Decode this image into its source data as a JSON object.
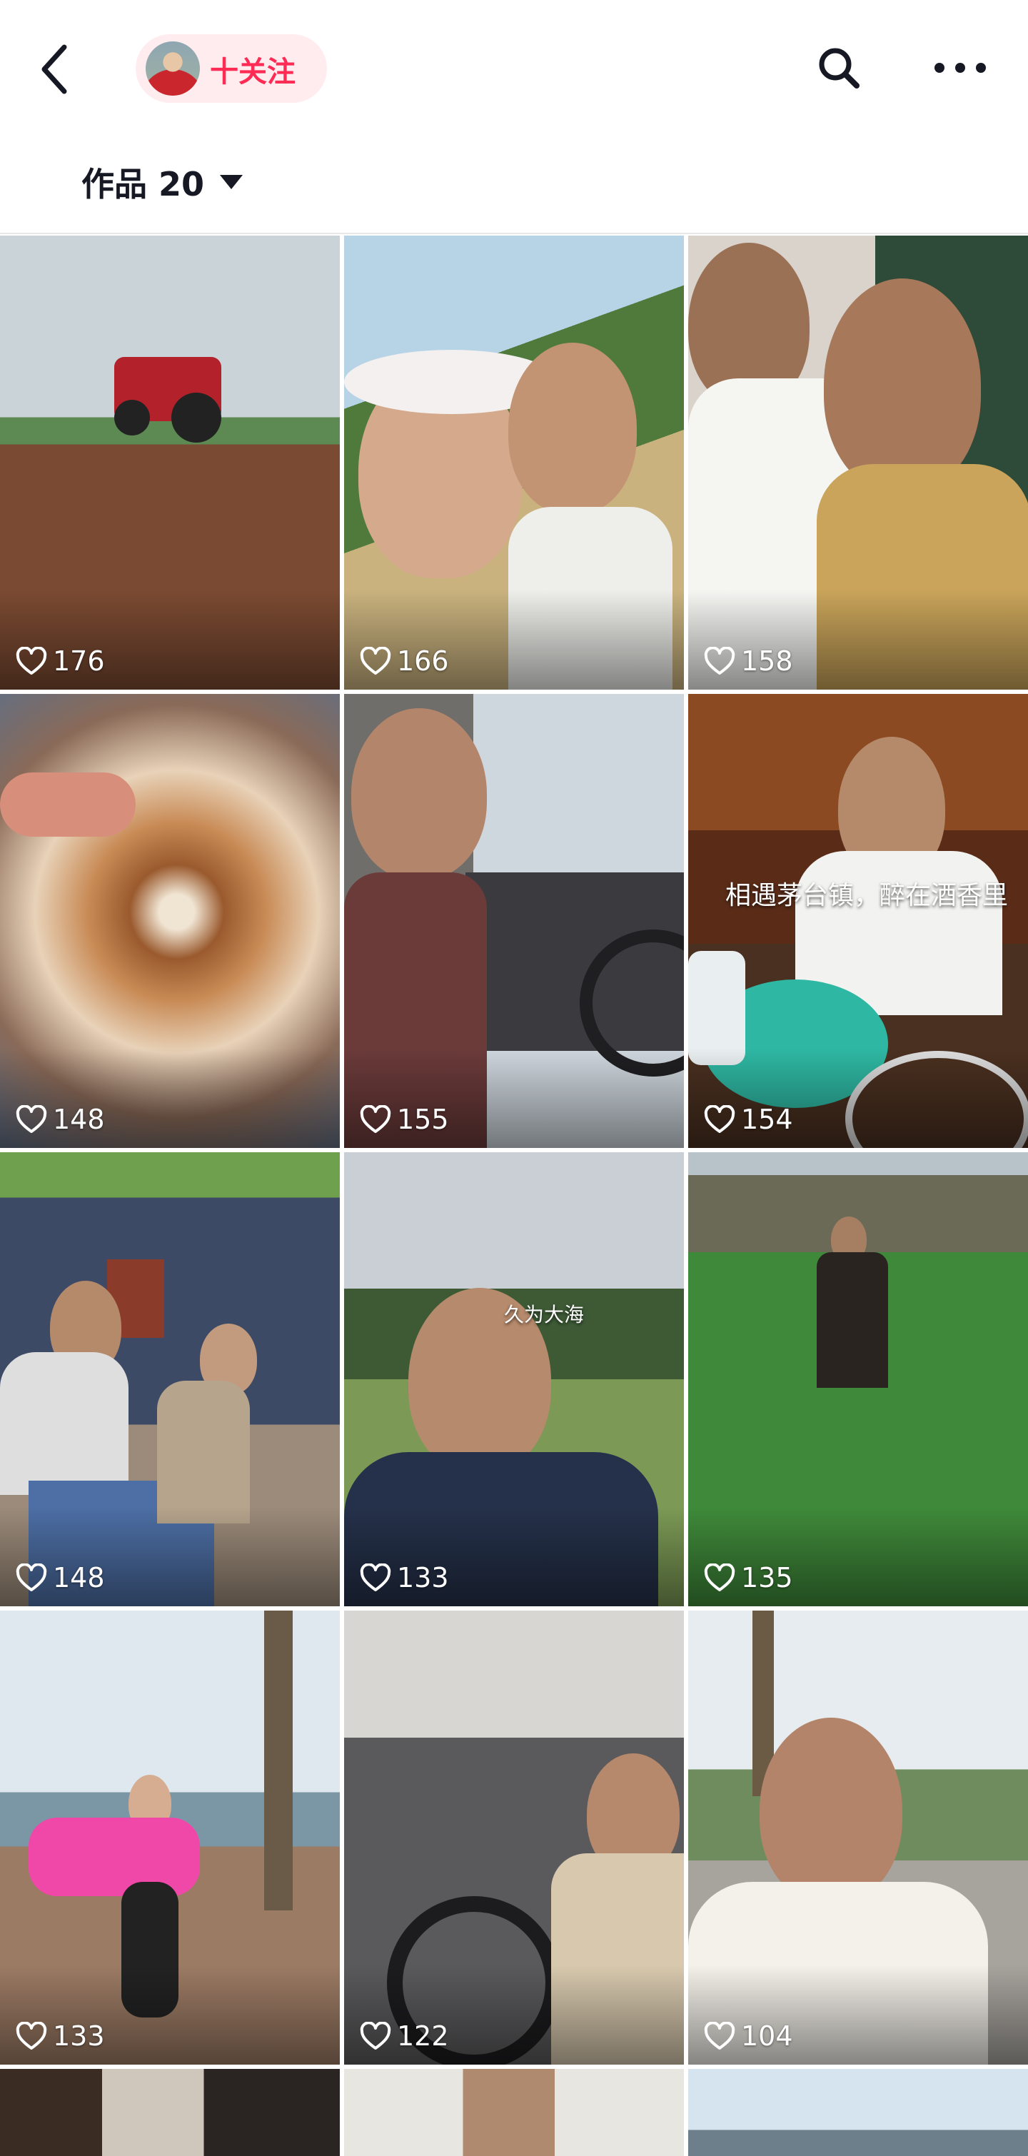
{
  "header": {
    "follow_label": "十关注"
  },
  "tab": {
    "label": "作品 20"
  },
  "videos": [
    {
      "likes": "176"
    },
    {
      "likes": "166"
    },
    {
      "likes": "158"
    },
    {
      "likes": "148"
    },
    {
      "likes": "155"
    },
    {
      "likes": "154",
      "caption": "相遇茅台镇，醉在酒香里"
    },
    {
      "likes": "148"
    },
    {
      "likes": "133",
      "caption": "久为大海"
    },
    {
      "likes": "135"
    },
    {
      "likes": "133"
    },
    {
      "likes": "122"
    },
    {
      "likes": "104"
    }
  ],
  "colors": {
    "accent": "#fe2c55",
    "follow_bg": "#feecef",
    "text": "#161823"
  }
}
